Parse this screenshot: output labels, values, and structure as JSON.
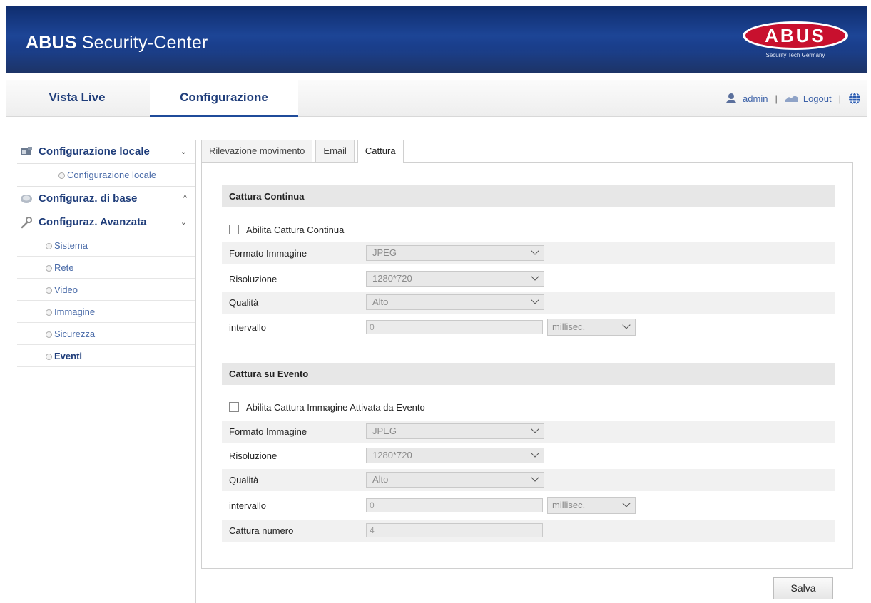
{
  "header": {
    "title_bold": "ABUS",
    "title_rest": " Security-Center",
    "logo_text": "ABUS",
    "logo_tagline": "Security Tech Germany"
  },
  "nav": {
    "tabs": [
      {
        "label": "Vista Live"
      },
      {
        "label": "Configurazione"
      }
    ],
    "user": "admin",
    "separator": "|",
    "logout": "Logout"
  },
  "sidebar": {
    "groups": [
      {
        "label": "Configurazione locale",
        "chevron": "⌄",
        "items": [
          {
            "label": "Configurazione locale"
          }
        ]
      },
      {
        "label": "Configuraz. di base",
        "chevron": "^"
      },
      {
        "label": "Configuraz. Avanzata",
        "chevron": "⌄",
        "items": [
          {
            "label": "Sistema"
          },
          {
            "label": "Rete"
          },
          {
            "label": "Video"
          },
          {
            "label": "Immagine"
          },
          {
            "label": "Sicurezza"
          },
          {
            "label": "Eventi"
          }
        ]
      }
    ]
  },
  "tabs": [
    {
      "label": "Rilevazione movimento"
    },
    {
      "label": "Email"
    },
    {
      "label": "Cattura"
    }
  ],
  "continuous": {
    "title": "Cattura Continua",
    "enable_label": "Abilita Cattura Continua",
    "rows": [
      {
        "label": "Formato Immagine",
        "value": "JPEG"
      },
      {
        "label": "Risoluzione",
        "value": "1280*720"
      },
      {
        "label": "Qualità",
        "value": "Alto"
      }
    ],
    "interval": {
      "label": "intervallo",
      "value": "0",
      "unit": "millisec."
    }
  },
  "event": {
    "title": "Cattura su Evento",
    "enable_label": "Abilita Cattura Immagine Attivata da Evento",
    "rows": [
      {
        "label": "Formato Immagine",
        "value": "JPEG"
      },
      {
        "label": "Risoluzione",
        "value": "1280*720"
      },
      {
        "label": "Qualità",
        "value": "Alto"
      }
    ],
    "interval": {
      "label": "intervallo",
      "value": "0",
      "unit": "millisec."
    },
    "count": {
      "label": "Cattura numero",
      "value": "4"
    }
  },
  "save_label": "Salva",
  "colors": {
    "brand_blue": "#1d4596",
    "logo_red": "#c8102e",
    "link_blue": "#1f3d7a"
  }
}
